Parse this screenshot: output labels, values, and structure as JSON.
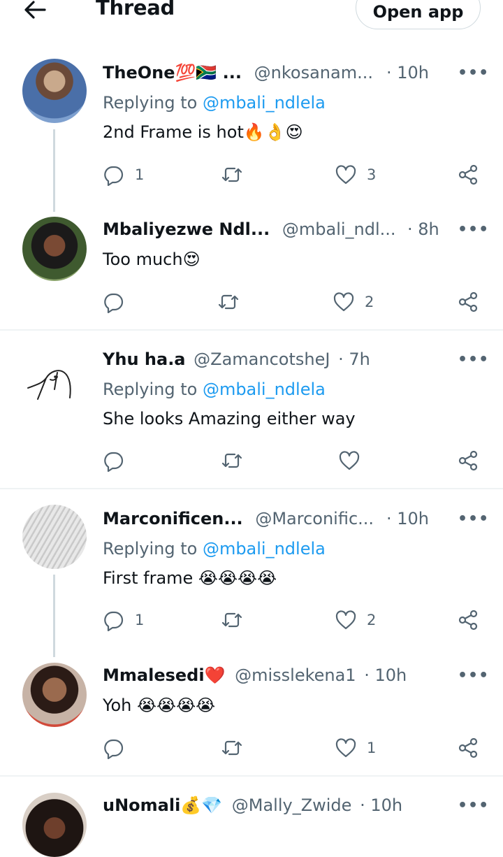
{
  "header": {
    "title": "Thread",
    "open_app": "Open app"
  },
  "tweets": [
    {
      "name": "TheOne💯🇿🇦 ...",
      "handle": "@nkosanam...",
      "time": "· 10h",
      "replying_prefix": "Replying to ",
      "replying_to": "@mbali_ndlela",
      "text": "2nd Frame is hot🔥👌😍",
      "replies": "1",
      "retweets": "",
      "likes": "3"
    },
    {
      "name": "Mbaliyezwe Ndl...",
      "handle": "@mbali_ndl...",
      "time": "· 8h",
      "text": "Too much😍",
      "replies": "",
      "retweets": "",
      "likes": "2"
    },
    {
      "name": "Yhu ha.a",
      "handle": "@ZamancotsheJ",
      "time": "· 7h",
      "replying_prefix": "Replying to ",
      "replying_to": "@mbali_ndlela",
      "text": "She looks Amazing either way",
      "replies": "",
      "retweets": "",
      "likes": ""
    },
    {
      "name": "Marconificen...",
      "handle": "@Marconific...",
      "time": "· 10h",
      "replying_prefix": "Replying to ",
      "replying_to": "@mbali_ndlela",
      "text": "First frame 😭😭😭😭",
      "replies": "1",
      "retweets": "",
      "likes": "2"
    },
    {
      "name": "Mmalesedi❤️",
      "handle": "@misslekena1",
      "time": "· 10h",
      "text": "Yoh 😭😭😭😭",
      "replies": "",
      "retweets": "",
      "likes": "1"
    },
    {
      "name": "uNomali💰💎",
      "handle": "@Mally_Zwide",
      "time": "· 10h"
    }
  ],
  "colors": {
    "accent": "#1d9bf0",
    "muted": "#536471",
    "text": "#0f1419",
    "divider": "#eff3f4"
  },
  "icons": [
    "back-arrow-icon",
    "more-icon",
    "reply-icon",
    "retweet-icon",
    "like-icon",
    "share-icon"
  ]
}
